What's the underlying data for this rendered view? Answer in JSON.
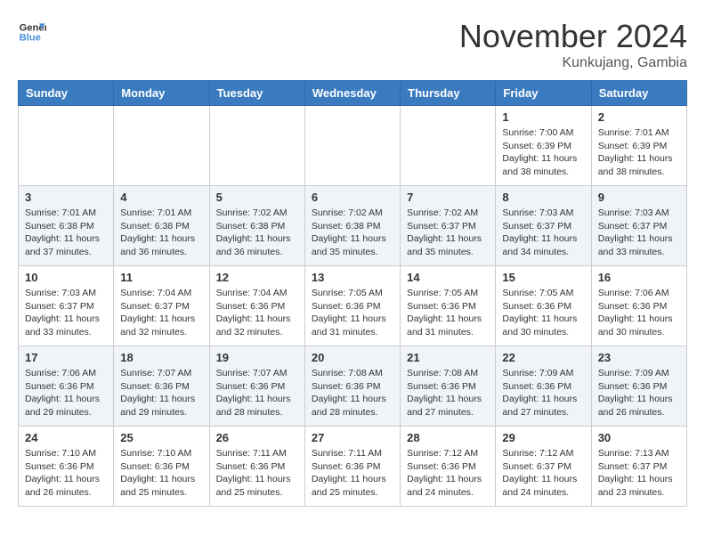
{
  "header": {
    "logo_line1": "General",
    "logo_line2": "Blue",
    "month_title": "November 2024",
    "location": "Kunkujang, Gambia"
  },
  "weekdays": [
    "Sunday",
    "Monday",
    "Tuesday",
    "Wednesday",
    "Thursday",
    "Friday",
    "Saturday"
  ],
  "weeks": [
    [
      {
        "day": "",
        "info": ""
      },
      {
        "day": "",
        "info": ""
      },
      {
        "day": "",
        "info": ""
      },
      {
        "day": "",
        "info": ""
      },
      {
        "day": "",
        "info": ""
      },
      {
        "day": "1",
        "info": "Sunrise: 7:00 AM\nSunset: 6:39 PM\nDaylight: 11 hours and 38 minutes."
      },
      {
        "day": "2",
        "info": "Sunrise: 7:01 AM\nSunset: 6:39 PM\nDaylight: 11 hours and 38 minutes."
      }
    ],
    [
      {
        "day": "3",
        "info": "Sunrise: 7:01 AM\nSunset: 6:38 PM\nDaylight: 11 hours and 37 minutes."
      },
      {
        "day": "4",
        "info": "Sunrise: 7:01 AM\nSunset: 6:38 PM\nDaylight: 11 hours and 36 minutes."
      },
      {
        "day": "5",
        "info": "Sunrise: 7:02 AM\nSunset: 6:38 PM\nDaylight: 11 hours and 36 minutes."
      },
      {
        "day": "6",
        "info": "Sunrise: 7:02 AM\nSunset: 6:38 PM\nDaylight: 11 hours and 35 minutes."
      },
      {
        "day": "7",
        "info": "Sunrise: 7:02 AM\nSunset: 6:37 PM\nDaylight: 11 hours and 35 minutes."
      },
      {
        "day": "8",
        "info": "Sunrise: 7:03 AM\nSunset: 6:37 PM\nDaylight: 11 hours and 34 minutes."
      },
      {
        "day": "9",
        "info": "Sunrise: 7:03 AM\nSunset: 6:37 PM\nDaylight: 11 hours and 33 minutes."
      }
    ],
    [
      {
        "day": "10",
        "info": "Sunrise: 7:03 AM\nSunset: 6:37 PM\nDaylight: 11 hours and 33 minutes."
      },
      {
        "day": "11",
        "info": "Sunrise: 7:04 AM\nSunset: 6:37 PM\nDaylight: 11 hours and 32 minutes."
      },
      {
        "day": "12",
        "info": "Sunrise: 7:04 AM\nSunset: 6:36 PM\nDaylight: 11 hours and 32 minutes."
      },
      {
        "day": "13",
        "info": "Sunrise: 7:05 AM\nSunset: 6:36 PM\nDaylight: 11 hours and 31 minutes."
      },
      {
        "day": "14",
        "info": "Sunrise: 7:05 AM\nSunset: 6:36 PM\nDaylight: 11 hours and 31 minutes."
      },
      {
        "day": "15",
        "info": "Sunrise: 7:05 AM\nSunset: 6:36 PM\nDaylight: 11 hours and 30 minutes."
      },
      {
        "day": "16",
        "info": "Sunrise: 7:06 AM\nSunset: 6:36 PM\nDaylight: 11 hours and 30 minutes."
      }
    ],
    [
      {
        "day": "17",
        "info": "Sunrise: 7:06 AM\nSunset: 6:36 PM\nDaylight: 11 hours and 29 minutes."
      },
      {
        "day": "18",
        "info": "Sunrise: 7:07 AM\nSunset: 6:36 PM\nDaylight: 11 hours and 29 minutes."
      },
      {
        "day": "19",
        "info": "Sunrise: 7:07 AM\nSunset: 6:36 PM\nDaylight: 11 hours and 28 minutes."
      },
      {
        "day": "20",
        "info": "Sunrise: 7:08 AM\nSunset: 6:36 PM\nDaylight: 11 hours and 28 minutes."
      },
      {
        "day": "21",
        "info": "Sunrise: 7:08 AM\nSunset: 6:36 PM\nDaylight: 11 hours and 27 minutes."
      },
      {
        "day": "22",
        "info": "Sunrise: 7:09 AM\nSunset: 6:36 PM\nDaylight: 11 hours and 27 minutes."
      },
      {
        "day": "23",
        "info": "Sunrise: 7:09 AM\nSunset: 6:36 PM\nDaylight: 11 hours and 26 minutes."
      }
    ],
    [
      {
        "day": "24",
        "info": "Sunrise: 7:10 AM\nSunset: 6:36 PM\nDaylight: 11 hours and 26 minutes."
      },
      {
        "day": "25",
        "info": "Sunrise: 7:10 AM\nSunset: 6:36 PM\nDaylight: 11 hours and 25 minutes."
      },
      {
        "day": "26",
        "info": "Sunrise: 7:11 AM\nSunset: 6:36 PM\nDaylight: 11 hours and 25 minutes."
      },
      {
        "day": "27",
        "info": "Sunrise: 7:11 AM\nSunset: 6:36 PM\nDaylight: 11 hours and 25 minutes."
      },
      {
        "day": "28",
        "info": "Sunrise: 7:12 AM\nSunset: 6:36 PM\nDaylight: 11 hours and 24 minutes."
      },
      {
        "day": "29",
        "info": "Sunrise: 7:12 AM\nSunset: 6:37 PM\nDaylight: 11 hours and 24 minutes."
      },
      {
        "day": "30",
        "info": "Sunrise: 7:13 AM\nSunset: 6:37 PM\nDaylight: 11 hours and 23 minutes."
      }
    ]
  ]
}
